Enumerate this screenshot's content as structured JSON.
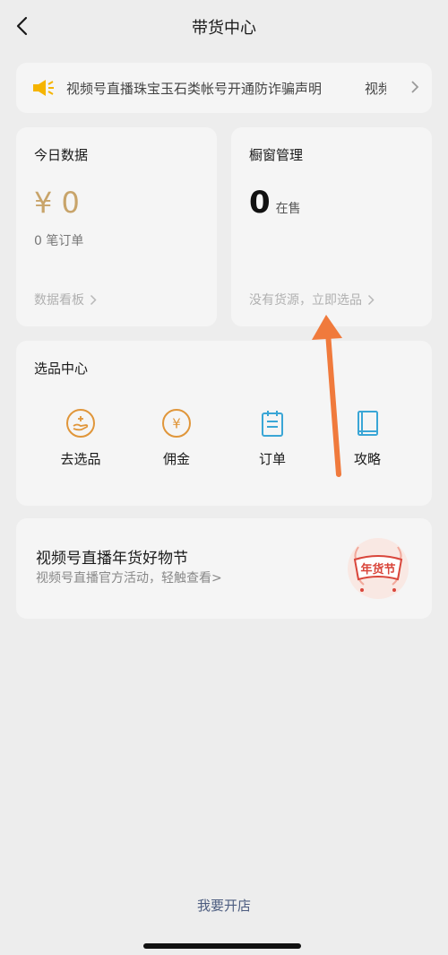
{
  "header": {
    "title": "带货中心"
  },
  "notice": {
    "text": "视频号直播珠宝玉石类帐号开通防诈骗声明",
    "text_next": "视频"
  },
  "today_card": {
    "title": "今日数据",
    "amount": "¥ 0",
    "orders": "0 笔订单",
    "link": "数据看板"
  },
  "window_card": {
    "title": "橱窗管理",
    "count": "0",
    "count_unit": "在售",
    "link": "没有货源，立即选品"
  },
  "select_center": {
    "title": "选品中心",
    "items": [
      {
        "label": "去选品",
        "icon": "select-product-icon"
      },
      {
        "label": "佣金",
        "icon": "yen-coin-icon"
      },
      {
        "label": "订单",
        "icon": "order-clipboard-icon"
      },
      {
        "label": "攻略",
        "icon": "guide-book-icon"
      }
    ]
  },
  "promo": {
    "title": "视频号直播年货好物节",
    "subtitle": "视频号直播官方活动，轻触查看>",
    "badge_text": "年货节"
  },
  "footer": {
    "open_store": "我要开店"
  },
  "colors": {
    "background": "#ededed",
    "card": "#f5f5f5",
    "gold": "#c8a46a",
    "orange_icon": "#e0963a",
    "blue_icon": "#3aa6d6",
    "link_blue": "#4d5d80",
    "annotation_arrow": "#f07a3c"
  }
}
